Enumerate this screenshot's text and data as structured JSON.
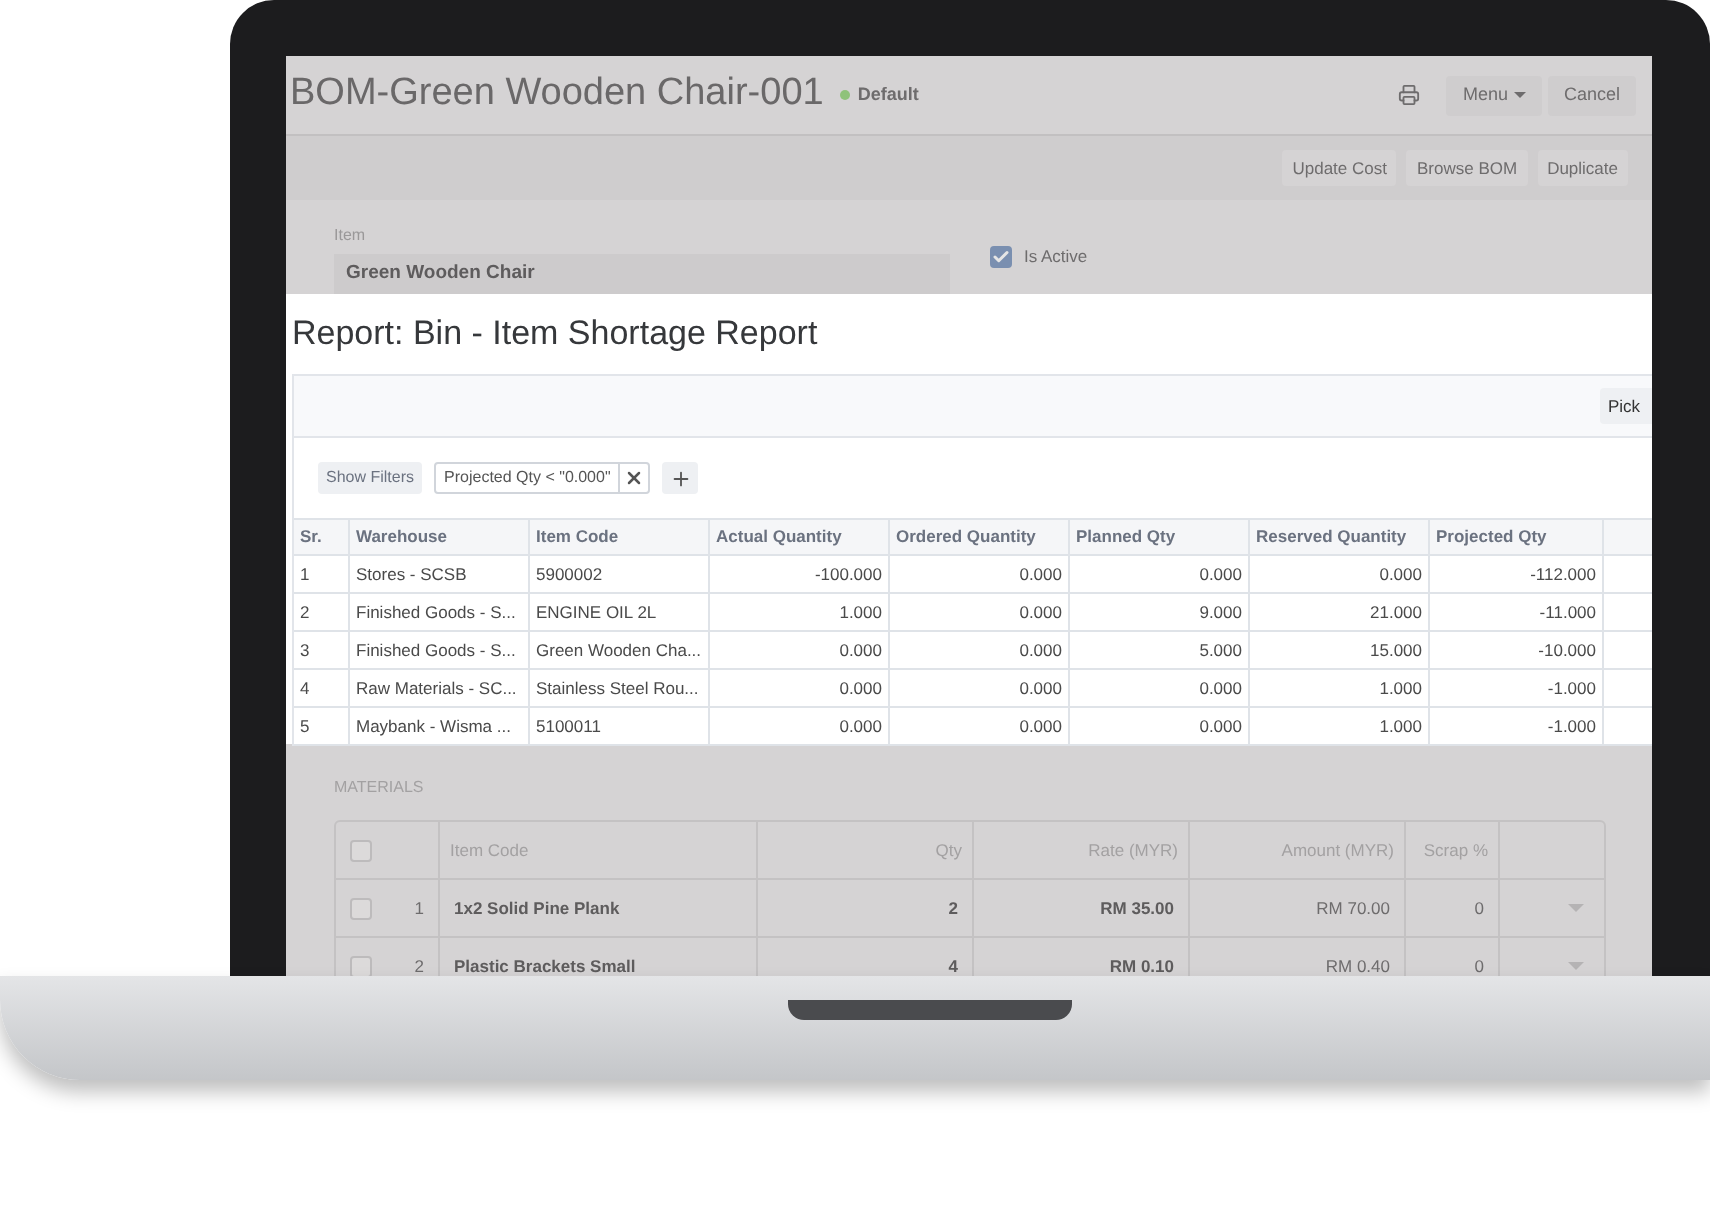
{
  "bom": {
    "title": "BOM-Green Wooden Chair-001",
    "status": "Default",
    "header_buttons": [
      {
        "label": "Menu",
        "kind": "dropdown"
      },
      {
        "label": "Cancel",
        "kind": "plain"
      }
    ],
    "actions": [
      "Update Cost",
      "Browse BOM",
      "Duplicate"
    ],
    "item": {
      "label": "Item",
      "value": "Green Wooden Chair"
    },
    "checks": [
      {
        "label": "Is Active",
        "checked": true
      }
    ],
    "materials": {
      "title": "MATERIALS",
      "select_all_checked": false,
      "columns": [
        "Item Code",
        "Qty",
        "Rate (MYR)",
        "Amount (MYR)",
        "Scrap %"
      ],
      "rows": [
        {
          "checked": false,
          "index": "1",
          "item_code": "1x2 Solid Pine Plank",
          "qty": "2",
          "rate": "RM 35.00",
          "amount": "RM 70.00",
          "scrap": "0"
        },
        {
          "checked": false,
          "index": "2",
          "item_code": "Plastic Brackets Small",
          "qty": "4",
          "rate": "RM 0.10",
          "amount": "RM 0.40",
          "scrap": "0"
        }
      ]
    }
  },
  "report": {
    "title": "Report: Bin - Item Shortage Report",
    "toolbar_button": "Pick",
    "show_filters": "Show Filters",
    "filters": [
      "Projected Qty < \"0.000\""
    ],
    "columns": [
      "Sr.",
      "Warehouse",
      "Item Code",
      "Actual Quantity",
      "Ordered Quantity",
      "Planned Qty",
      "Reserved Quantity",
      "Projected Qty"
    ],
    "rows": [
      [
        "1",
        "Stores - SCSB",
        "5900002",
        "-100.000",
        "0.000",
        "0.000",
        "0.000",
        "-112.000"
      ],
      [
        "2",
        "Finished Goods - S...",
        "ENGINE OIL 2L",
        "1.000",
        "0.000",
        "9.000",
        "21.000",
        "-11.000"
      ],
      [
        "3",
        "Finished Goods - S...",
        "Green Wooden Cha...",
        "0.000",
        "0.000",
        "5.000",
        "15.000",
        "-10.000"
      ],
      [
        "4",
        "Raw Materials - SC...",
        "Stainless Steel Rou...",
        "0.000",
        "0.000",
        "0.000",
        "1.000",
        "-1.000"
      ],
      [
        "5",
        "Maybank - Wisma ...",
        "5100011",
        "0.000",
        "0.000",
        "0.000",
        "1.000",
        "-1.000"
      ]
    ]
  }
}
